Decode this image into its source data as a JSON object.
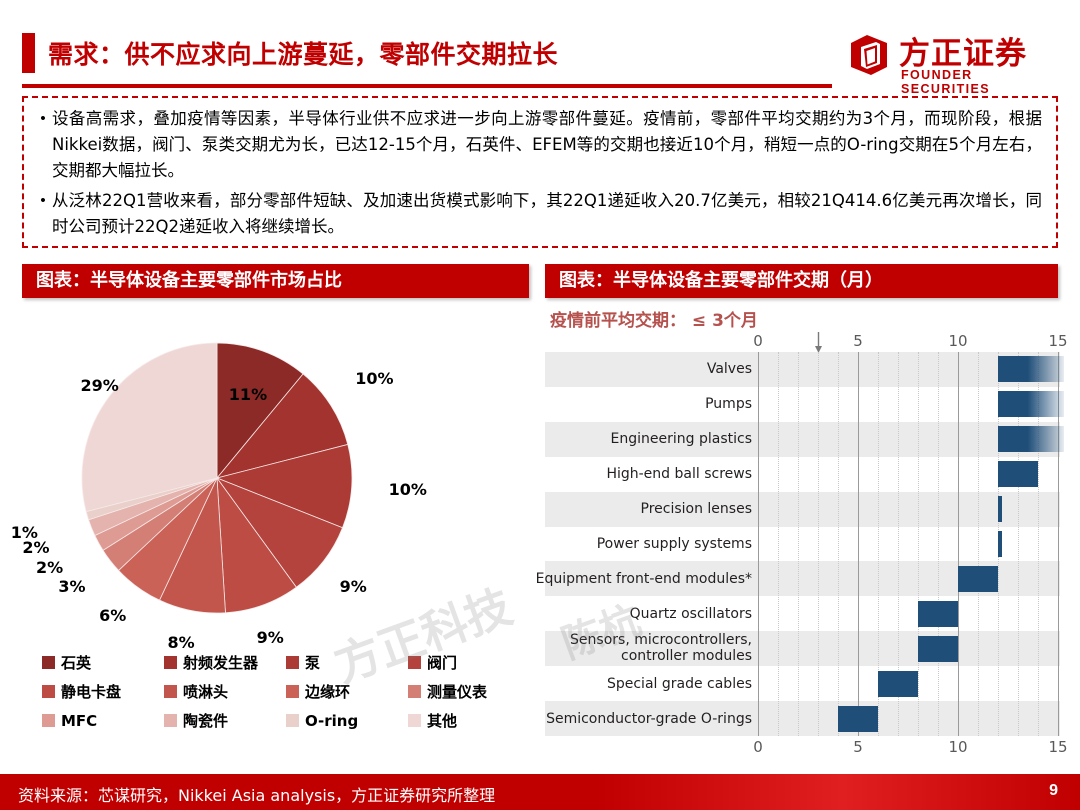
{
  "header": {
    "title": "需求：供不应求向上游蔓延，零部件交期拉长",
    "logo_cn": "方正证券",
    "logo_en": "FOUNDER SECURITIES"
  },
  "body": {
    "bullet_marker": "•",
    "bullets": [
      "设备高需求，叠加疫情等因素，半导体行业供不应求进一步向上游零部件蔓延。疫情前，零部件平均交期约为3个月，而现阶段，根据Nikkei数据，阀门、泵类交期尤为长，已达12-15个月，石英件、EFEM等的交期也接近10个月，稍短一点的O-ring交期在5个月左右，交期都大幅拉长。",
      "从泛林22Q1营收来看，部分零部件短缺、及加速出货模式影响下，其22Q1递延收入20.7亿美元，相较21Q414.6亿美元再次增长，同时公司预计22Q2递延收入将继续增长。"
    ]
  },
  "pie_panel": {
    "title": "图表：半导体设备主要零部件市场占比"
  },
  "bar_panel": {
    "title": "图表：半导体设备主要零部件交期（月）",
    "subtitle": "疫情前平均交期： ≤ 3个月"
  },
  "watermarks": [
    "方正科技",
    "陈杭",
    "科技"
  ],
  "footer": {
    "source": "资料来源：芯谋研究，Nikkei Asia analysis，方正证券研究所整理",
    "page": "9"
  },
  "chart_data": [
    {
      "type": "pie",
      "title": "图表：半导体设备主要零部件市场占比",
      "legend_position": "bottom",
      "categories": [
        "石英",
        "射频发生器",
        "泵",
        "阀门",
        "静电卡盘",
        "喷淋头",
        "边缘环",
        "测量仪表",
        "MFC",
        "陶瓷件",
        "O-ring",
        "其他"
      ],
      "values": [
        11,
        10,
        10,
        9,
        9,
        8,
        6,
        3,
        2,
        2,
        1,
        29
      ],
      "data_labels": [
        "11%",
        "10%",
        "10%",
        "9%",
        "9%",
        "8%",
        "6%",
        "3%",
        "2%",
        "2%",
        "1%",
        "29%"
      ],
      "colors": [
        "#8c2a28",
        "#a3332f",
        "#ac3a35",
        "#b4433d",
        "#bc4c44",
        "#c3564c",
        "#cb6258",
        "#d47f76",
        "#dd9b94",
        "#e4b3ad",
        "#ead0cb",
        "#eed7d4"
      ],
      "unit": "%"
    },
    {
      "type": "bar",
      "subtype": "range-bar",
      "title": "图表：半导体设备主要零部件交期（月）",
      "annotation": "疫情前平均交期： ≤ 3个月",
      "annotation_marker_value": 3,
      "xlabel": "",
      "ylabel": "",
      "xlim": [
        0,
        15
      ],
      "xticks": [
        0,
        5,
        10,
        15
      ],
      "xtick_labels": [
        "0",
        "5",
        "10",
        "15"
      ],
      "minor_gridlines": [
        1,
        2,
        3,
        4,
        6,
        7,
        8,
        9,
        11,
        12,
        13,
        14
      ],
      "grid": true,
      "bar_color": "#1f4e79",
      "categories": [
        "Valves",
        "Pumps",
        "Engineering plastics",
        "High-end ball screws",
        "Precision lenses",
        "Power supply systems",
        "Equipment front-end modules*",
        "Quartz oscillators",
        "Sensors, microcontrollers, controller modules",
        "Special grade cables",
        "Semiconductor-grade O-rings"
      ],
      "ranges": [
        {
          "label": "Valves",
          "start": 12,
          "end": 15,
          "open_ended": true
        },
        {
          "label": "Pumps",
          "start": 12,
          "end": 15,
          "open_ended": true
        },
        {
          "label": "Engineering plastics",
          "start": 12,
          "end": 15,
          "open_ended": true
        },
        {
          "label": "High-end ball screws",
          "start": 12,
          "end": 14,
          "open_ended": false
        },
        {
          "label": "Precision lenses",
          "start": 12,
          "end": 12.2,
          "open_ended": false
        },
        {
          "label": "Power supply systems",
          "start": 12,
          "end": 12.2,
          "open_ended": false
        },
        {
          "label": "Equipment front-end modules*",
          "start": 10,
          "end": 12,
          "open_ended": false
        },
        {
          "label": "Quartz oscillators",
          "start": 8,
          "end": 10,
          "open_ended": false
        },
        {
          "label": "Sensors, microcontrollers, controller modules",
          "start": 8,
          "end": 10,
          "open_ended": false
        },
        {
          "label": "Special grade cables",
          "start": 6,
          "end": 8,
          "open_ended": false
        },
        {
          "label": "Semiconductor-grade O-rings",
          "start": 4,
          "end": 6,
          "open_ended": false
        }
      ]
    }
  ]
}
